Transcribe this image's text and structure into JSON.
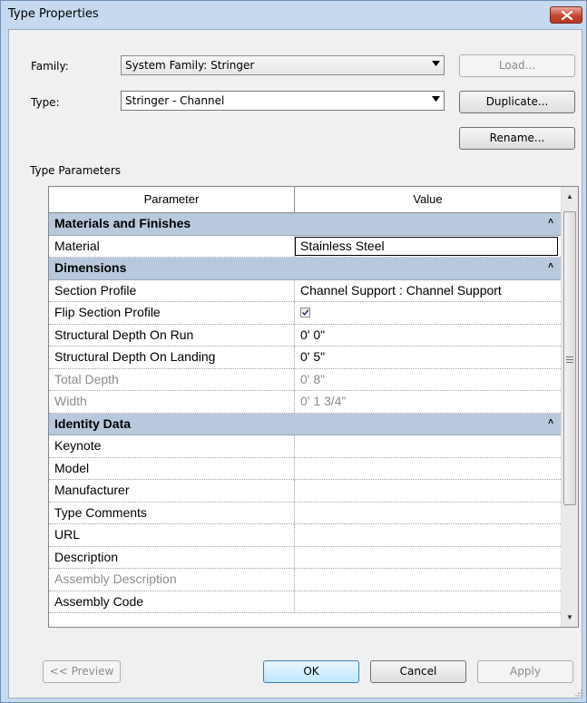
{
  "window": {
    "title": "Type Properties"
  },
  "family": {
    "label": "Family:",
    "value": "System Family: Stringer"
  },
  "type": {
    "label": "Type:",
    "value": "Stringer - Channel"
  },
  "buttons": {
    "load": "Load...",
    "duplicate": "Duplicate...",
    "rename": "Rename...",
    "preview": "<< Preview",
    "ok": "OK",
    "cancel": "Cancel",
    "apply": "Apply"
  },
  "section_label": "Type Parameters",
  "grid": {
    "col_parameter": "Parameter",
    "col_value": "Value",
    "groups": {
      "materials": {
        "name": "Materials and Finishes",
        "chevron": "˄"
      },
      "dimensions": {
        "name": "Dimensions",
        "chevron": "˄"
      },
      "identity": {
        "name": "Identity Data",
        "chevron": "˄"
      }
    },
    "rows": {
      "material": {
        "name": "Material",
        "value": "Stainless Steel"
      },
      "section_profile": {
        "name": "Section Profile",
        "value": "Channel Support : Channel Support"
      },
      "flip_section_profile": {
        "name": "Flip Section Profile",
        "checked": true
      },
      "structural_depth_run": {
        "name": "Structural Depth On Run",
        "value": "0'  0\""
      },
      "structural_depth_landing": {
        "name": "Structural Depth On Landing",
        "value": "0'  5\""
      },
      "total_depth": {
        "name": "Total Depth",
        "value": "0'  8\""
      },
      "width": {
        "name": "Width",
        "value": "0'  1 3/4\""
      },
      "keynote": {
        "name": "Keynote",
        "value": ""
      },
      "model": {
        "name": "Model",
        "value": ""
      },
      "manufacturer": {
        "name": "Manufacturer",
        "value": ""
      },
      "type_comments": {
        "name": "Type Comments",
        "value": ""
      },
      "url": {
        "name": "URL",
        "value": ""
      },
      "description": {
        "name": "Description",
        "value": ""
      },
      "assembly_description": {
        "name": "Assembly Description",
        "value": ""
      },
      "assembly_code": {
        "name": "Assembly Code",
        "value": ""
      }
    }
  },
  "colors": {
    "titlebar": "#c6d9ee",
    "group_header": "#b9c9dd",
    "close_button": "#c9452f",
    "disabled_text": "#8c8c8c"
  }
}
